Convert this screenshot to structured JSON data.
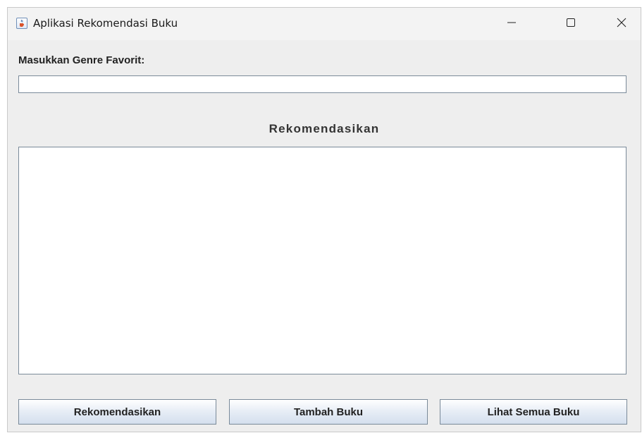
{
  "window": {
    "title": "Aplikasi Rekomendasi Buku",
    "icons": {
      "app": "java-cup-icon",
      "minimize": "minimize-icon",
      "maximize": "maximize-icon",
      "close": "close-icon"
    }
  },
  "form": {
    "genre_label": "Masukkan Genre Favorit:",
    "genre_value": "",
    "result_title": "Rekomendasikan",
    "result_text": ""
  },
  "buttons": {
    "recommend": "Rekomendasikan",
    "add_book": "Tambah Buku",
    "view_all": "Lihat Semua Buku"
  },
  "colors": {
    "window_bg": "#eeeeee",
    "border": "#7a8a99",
    "button_gradient_top": "#ffffff",
    "button_gradient_bottom": "#d4dfee"
  }
}
